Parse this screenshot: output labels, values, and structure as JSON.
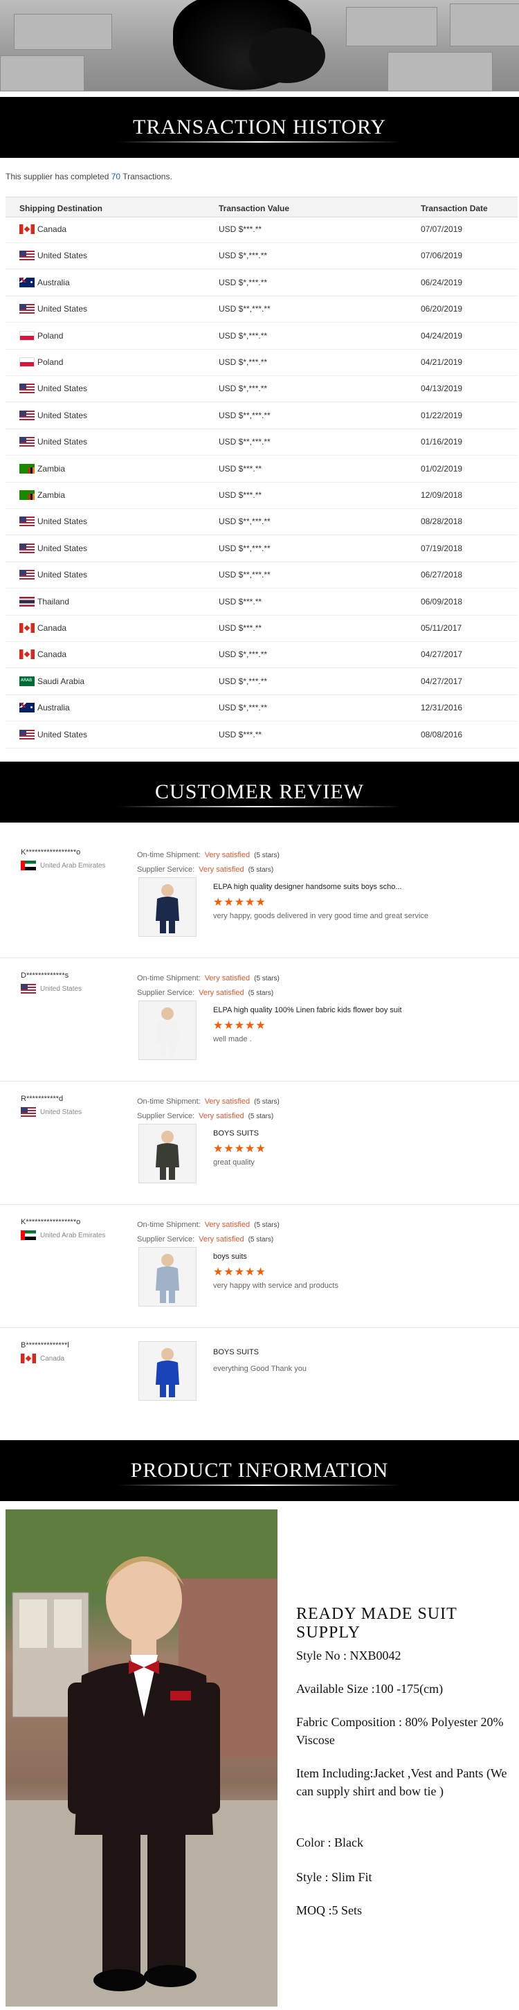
{
  "banners": {
    "transaction": "TRANSACTION HISTORY",
    "review": "CUSTOMER REVIEW",
    "product": "PRODUCT INFORMATION"
  },
  "transactions": {
    "intro_before": "This supplier has completed ",
    "count": "70",
    "intro_after": " Transactions.",
    "headers": {
      "destination": "Shipping Destination",
      "value": "Transaction Value",
      "date": "Transaction Date"
    },
    "rows": [
      {
        "flag": "ca",
        "country": "Canada",
        "value": "USD $***.**",
        "date": "07/07/2019"
      },
      {
        "flag": "us",
        "country": "United States",
        "value": "USD $*,***.**",
        "date": "07/06/2019"
      },
      {
        "flag": "au",
        "country": "Australia",
        "value": "USD $*,***.**",
        "date": "06/24/2019"
      },
      {
        "flag": "us",
        "country": "United States",
        "value": "USD $**,***.**",
        "date": "06/20/2019"
      },
      {
        "flag": "pl",
        "country": "Poland",
        "value": "USD $*,***.**",
        "date": "04/24/2019"
      },
      {
        "flag": "pl",
        "country": "Poland",
        "value": "USD $*,***.**",
        "date": "04/21/2019"
      },
      {
        "flag": "us",
        "country": "United States",
        "value": "USD $*,***.**",
        "date": "04/13/2019"
      },
      {
        "flag": "us",
        "country": "United States",
        "value": "USD $**,***.**",
        "date": "01/22/2019"
      },
      {
        "flag": "us",
        "country": "United States",
        "value": "USD $**,***.**",
        "date": "01/16/2019"
      },
      {
        "flag": "zm",
        "country": "Zambia",
        "value": "USD $***.**",
        "date": "01/02/2019"
      },
      {
        "flag": "zm",
        "country": "Zambia",
        "value": "USD $***.**",
        "date": "12/09/2018"
      },
      {
        "flag": "us",
        "country": "United States",
        "value": "USD $**,***.**",
        "date": "08/28/2018"
      },
      {
        "flag": "us",
        "country": "United States",
        "value": "USD $**,***.**",
        "date": "07/19/2018"
      },
      {
        "flag": "us",
        "country": "United States",
        "value": "USD $**,***.**",
        "date": "06/27/2018"
      },
      {
        "flag": "th",
        "country": "Thailand",
        "value": "USD $***.**",
        "date": "06/09/2018"
      },
      {
        "flag": "ca",
        "country": "Canada",
        "value": "USD $***.**",
        "date": "05/11/2017"
      },
      {
        "flag": "ca",
        "country": "Canada",
        "value": "USD $*,***.**",
        "date": "04/27/2017"
      },
      {
        "flag": "sa",
        "country": "Saudi Arabia",
        "value": "USD $*,***.**",
        "date": "04/27/2017"
      },
      {
        "flag": "au",
        "country": "Australia",
        "value": "USD $*,***.**",
        "date": "12/31/2016"
      },
      {
        "flag": "us",
        "country": "United States",
        "value": "USD $***.**",
        "date": "08/08/2016"
      }
    ]
  },
  "reviews": {
    "labels": {
      "shipment": "On-time Shipment:",
      "service": "Supplier Service:"
    },
    "items": [
      {
        "buyer": "K*****************o",
        "country": "United Arab Emirates",
        "flag": "ae",
        "shipment": "Very satisfied",
        "shipment_stars": "(5 stars)",
        "service": "Very satisfied",
        "service_stars": "(5 stars)",
        "title": "ELPA high quality designer handsome suits boys scho...",
        "stars": "★★★★★",
        "comment": "very happy, goods delivered in very good time and great service"
      },
      {
        "buyer": "D*************s",
        "country": "United States",
        "flag": "us",
        "shipment": "Very satisfied",
        "shipment_stars": "(5 stars)",
        "service": "Very satisfied",
        "service_stars": "(5 stars)",
        "title": "ELPA high quality 100% Linen fabric kids flower boy suit",
        "stars": "★★★★★",
        "comment": "well made ."
      },
      {
        "buyer": "R***********d",
        "country": "United States",
        "flag": "us",
        "shipment": "Very satisfied",
        "shipment_stars": "(5 stars)",
        "service": "Very satisfied",
        "service_stars": "(5 stars)",
        "title": "BOYS SUITS",
        "stars": "★★★★★",
        "comment": "great quality"
      },
      {
        "buyer": "K*****************o",
        "country": "United Arab Emirates",
        "flag": "ae",
        "shipment": "Very satisfied",
        "shipment_stars": "(5 stars)",
        "service": "Very satisfied",
        "service_stars": "(5 stars)",
        "title": "boys suits",
        "stars": "★★★★★",
        "comment": "very happy with service and products"
      },
      {
        "buyer": "B**************l",
        "country": "Canada",
        "flag": "ca",
        "shipment": "",
        "shipment_stars": "",
        "service": "",
        "service_stars": "",
        "title": "BOYS SUITS",
        "stars": "",
        "comment": "everything Good Thank you"
      }
    ]
  },
  "product": {
    "heading": "READY MADE SUIT SUPPLY",
    "style_no": "Style No : NXB0042",
    "size": "Available Size :100 -175(cm)",
    "fabric": "Fabric Composition : 80% Polyester 20% Viscose",
    "items": "Item Including:Jacket ,Vest and Pants (We can supply shirt and bow tie )",
    "color": "Color : Black",
    "style": "Style : Slim Fit",
    "moq": "MOQ :5 Sets"
  }
}
